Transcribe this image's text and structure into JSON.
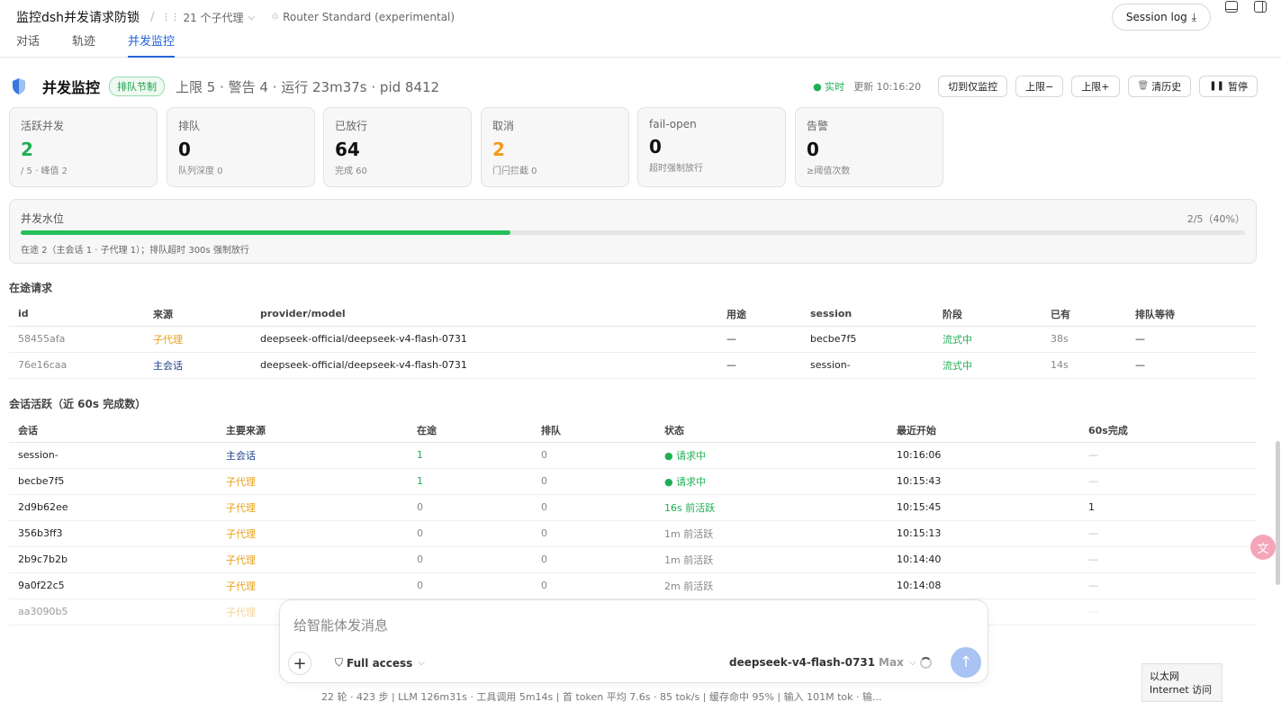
{
  "header": {
    "app_title": "监控dsh并发请求防锁",
    "subagents": "21 个子代理",
    "router": "Router Standard (experimental)",
    "session_log": "Session log",
    "tabs": [
      {
        "label": "对话",
        "active": false
      },
      {
        "label": "轨迹",
        "active": false
      },
      {
        "label": "并发监控",
        "active": true
      }
    ]
  },
  "monitor": {
    "title": "并发监控",
    "mode_badge": "排队节制",
    "stats": "上限 5 · 警告 4 · 运行 23m37s · pid 8412",
    "live": "● 实时",
    "updated": "更新 10:16:20",
    "buttons": {
      "switch": "切到仅监控",
      "limit_down": "上限−",
      "limit_up": "上限+",
      "clear": "清历史",
      "pause": "暂停"
    }
  },
  "cards": [
    {
      "label": "活跃并发",
      "value": "2",
      "sub": "/ 5 · 峰值 2",
      "color": "green"
    },
    {
      "label": "排队",
      "value": "0",
      "sub": "队列深度 0",
      "color": ""
    },
    {
      "label": "已放行",
      "value": "64",
      "sub": "完成 60",
      "color": ""
    },
    {
      "label": "取消",
      "value": "2",
      "sub": "门闩拦截 0",
      "color": "orange"
    },
    {
      "label": "fail-open",
      "value": "0",
      "sub": "超时强制放行",
      "color": ""
    },
    {
      "label": "告警",
      "value": "0",
      "sub": "≥阈值次数",
      "color": ""
    }
  ],
  "water_level": {
    "title": "并发水位",
    "ratio_text": "2/5（40%）",
    "fraction": 0.4,
    "note": "在途 2（主会话 1 · 子代理 1）；排队超时 300s 强制放行"
  },
  "inflight": {
    "title": "在途请求",
    "headers": [
      "id",
      "来源",
      "provider/model",
      "用途",
      "session",
      "阶段",
      "已有",
      "排队等待"
    ],
    "rows": [
      [
        "58455afa",
        "子代理",
        "deepseek-official/deepseek-v4-flash-0731",
        "—",
        "becbe7f5",
        "流式中",
        "38s",
        "—"
      ],
      [
        "76e16caa",
        "主会话",
        "deepseek-official/deepseek-v4-flash-0731",
        "—",
        "session-",
        "流式中",
        "14s",
        "—"
      ]
    ]
  },
  "sessions": {
    "title": "会话活跃（近 60s 完成数）",
    "headers": [
      "会话",
      "主要来源",
      "在途",
      "排队",
      "状态",
      "最近开始",
      "60s完成"
    ],
    "rows": [
      [
        "session-",
        "主会话",
        "1",
        "0",
        "● 请求中",
        "10:16:06",
        "—"
      ],
      [
        "becbe7f5",
        "子代理",
        "1",
        "0",
        "● 请求中",
        "10:15:43",
        "—"
      ],
      [
        "2d9b62ee",
        "子代理",
        "0",
        "0",
        "16s 前活跃",
        "10:15:45",
        "1"
      ],
      [
        "356b3ff3",
        "子代理",
        "0",
        "0",
        "1m 前活跃",
        "10:15:13",
        "—"
      ],
      [
        "2b9c7b2b",
        "子代理",
        "0",
        "0",
        "1m 前活跃",
        "10:14:40",
        "—"
      ],
      [
        "9a0f22c5",
        "子代理",
        "0",
        "0",
        "2m 前活跃",
        "10:14:08",
        "—"
      ],
      [
        "aa3090b5",
        "子代理",
        "",
        "",
        "",
        "",
        "—"
      ]
    ]
  },
  "composer": {
    "placeholder": "给智能体发消息",
    "access": "Full access",
    "model": "deepseek-v4-flash-0731",
    "tier": "Max"
  },
  "footer": "22 轮 · 423 步  |  LLM 126m31s · 工具调用 5m14s  |  首 token 平均 7.6s · 85 tok/s  |  缓存命中 95%  |  输入 101M tok · 输...",
  "network_tip": {
    "line1": "以太网",
    "line2": "Internet 访问"
  },
  "colors": {
    "accent": "#2464d9",
    "green": "#1fae55",
    "orange": "#f29b1d",
    "subagent": "#e8a21a",
    "main_session": "#1c3f8c"
  },
  "icons": {
    "subagents": "grid-dots-icon",
    "router": "router-icon",
    "session_log": "download-icon",
    "monitor": "shield-icon",
    "clear": "trash-icon",
    "pause": "pause-icon",
    "add": "plus-icon",
    "access": "shield-icon",
    "send": "arrow-up-icon"
  }
}
